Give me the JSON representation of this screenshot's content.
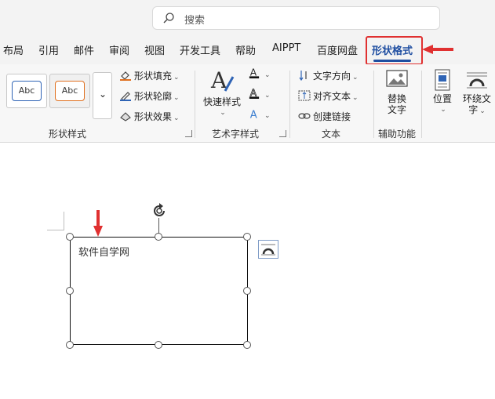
{
  "search": {
    "placeholder": "搜索",
    "icon": "search-icon"
  },
  "tabs": [
    {
      "label": "布局"
    },
    {
      "label": "引用"
    },
    {
      "label": "邮件"
    },
    {
      "label": "审阅"
    },
    {
      "label": "视图"
    },
    {
      "label": "开发工具"
    },
    {
      "label": "帮助"
    },
    {
      "label": "AIPPT"
    },
    {
      "label": "百度网盘"
    },
    {
      "label": "形状格式",
      "active": true
    }
  ],
  "ribbon": {
    "shape_styles": {
      "label": "形状样式",
      "gallery": [
        {
          "text": "Abc",
          "color": "#2f64b5"
        },
        {
          "text": "Abc",
          "color": "#e07020"
        }
      ],
      "fill": "形状填充",
      "outline": "形状轮廓",
      "effects": "形状效果"
    },
    "wordart": {
      "label": "艺术字样式",
      "quick_styles": "快速样式"
    },
    "text": {
      "label": "文本",
      "direction": "文字方向",
      "align": "对齐文本",
      "link": "创建链接"
    },
    "accessibility": {
      "label": "辅助功能",
      "alt_text_line1": "替换",
      "alt_text_line2": "文字"
    },
    "arrange": {
      "position": "位置",
      "wrap_line1": "环绕文",
      "wrap_line2": "字"
    }
  },
  "document": {
    "shape_text": "软件自学网"
  },
  "colors": {
    "accent": "#1f4ea1",
    "highlight": "#e03030"
  }
}
